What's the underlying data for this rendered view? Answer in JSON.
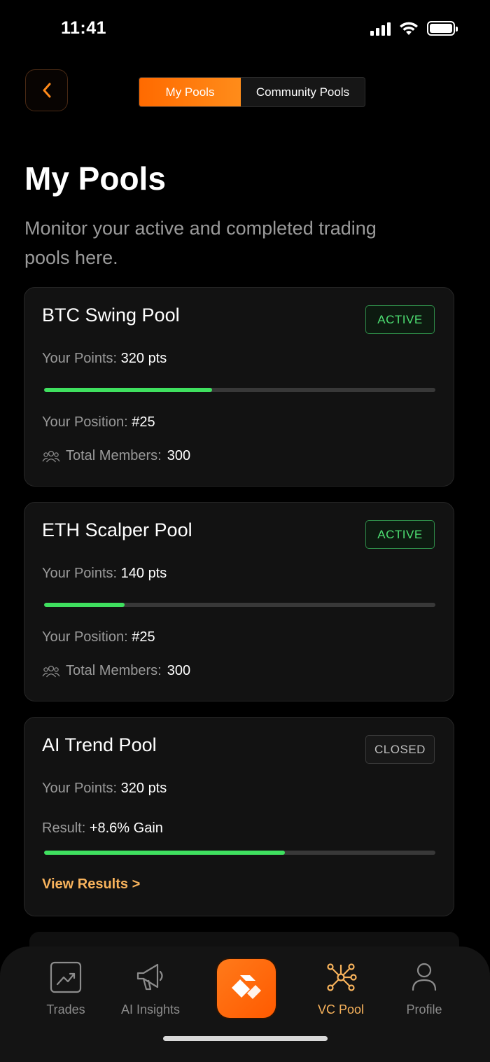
{
  "status_bar": {
    "time": "11:41"
  },
  "header": {
    "tabs": [
      {
        "label": "My Pools",
        "active": true
      },
      {
        "label": "Community Pools",
        "active": false
      }
    ]
  },
  "page": {
    "title": "My Pools",
    "subtitle": "Monitor your active and completed trading pools here."
  },
  "pools": [
    {
      "name": "BTC Swing Pool",
      "status": "ACTIVE",
      "points_label": "Your Points:",
      "points_value": "320 pts",
      "progress": 0.43,
      "position_label": "Your Position:",
      "position_value": "#25",
      "members_label": "Total Members:",
      "members_value": "300"
    },
    {
      "name": "ETH Scalper Pool",
      "status": "ACTIVE",
      "points_label": "Your Points:",
      "points_value": "140 pts",
      "progress": 0.205,
      "position_label": "Your Position:",
      "position_value": "#25",
      "members_label": "Total Members:",
      "members_value": "300"
    },
    {
      "name": "AI Trend Pool",
      "status": "CLOSED",
      "points_label": "Your Points:",
      "points_value": "320 pts",
      "result_label": "Result:",
      "result_value": "+8.6% Gain",
      "progress": 0.615,
      "link_label": "View Results >"
    }
  ],
  "colors": {
    "accent": "#ff6a00",
    "active_green": "#4ddf72",
    "progress_green": "#3fe05f",
    "link": "#f8b35c"
  },
  "nav": {
    "items": [
      {
        "label": "Trades",
        "icon": "chart-trend-icon"
      },
      {
        "label": "AI Insights",
        "icon": "megaphone-icon"
      },
      {
        "label": "",
        "icon": "app-logo-icon"
      },
      {
        "label": "VC Pool",
        "icon": "network-icon",
        "active": true
      },
      {
        "label": "Profile",
        "icon": "user-icon"
      }
    ]
  }
}
